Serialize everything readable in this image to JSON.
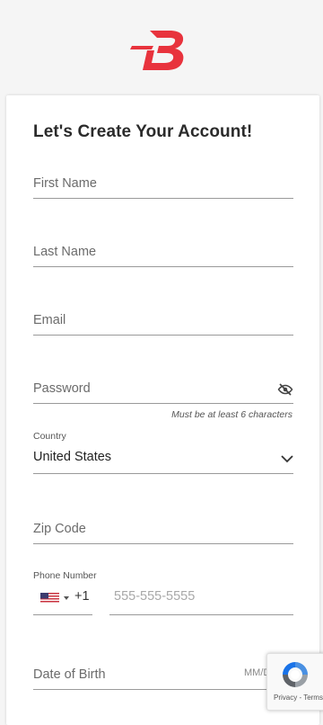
{
  "brand": {
    "logo_letter": "B",
    "color": "#e8333d"
  },
  "form": {
    "title": "Let's Create Your Account!",
    "first_name_placeholder": "First Name",
    "last_name_placeholder": "Last Name",
    "email_placeholder": "Email",
    "password_placeholder": "Password",
    "password_hint": "Must be at least 6 characters",
    "country_label": "Country",
    "country_value": "United States",
    "zip_placeholder": "Zip Code",
    "phone_label": "Phone Number",
    "phone_dial_code": "+1",
    "phone_placeholder": "555-555-5555",
    "dob_placeholder": "Date of Birth",
    "dob_format": "MM/DD/YY"
  },
  "recaptcha": {
    "terms_text": "Privacy - Terms"
  },
  "icons": {
    "password_toggle": "eye-slash-icon",
    "country_dropdown": "chevron-down-icon",
    "flag": "us-flag-icon",
    "recaptcha": "recaptcha-logo-icon"
  }
}
